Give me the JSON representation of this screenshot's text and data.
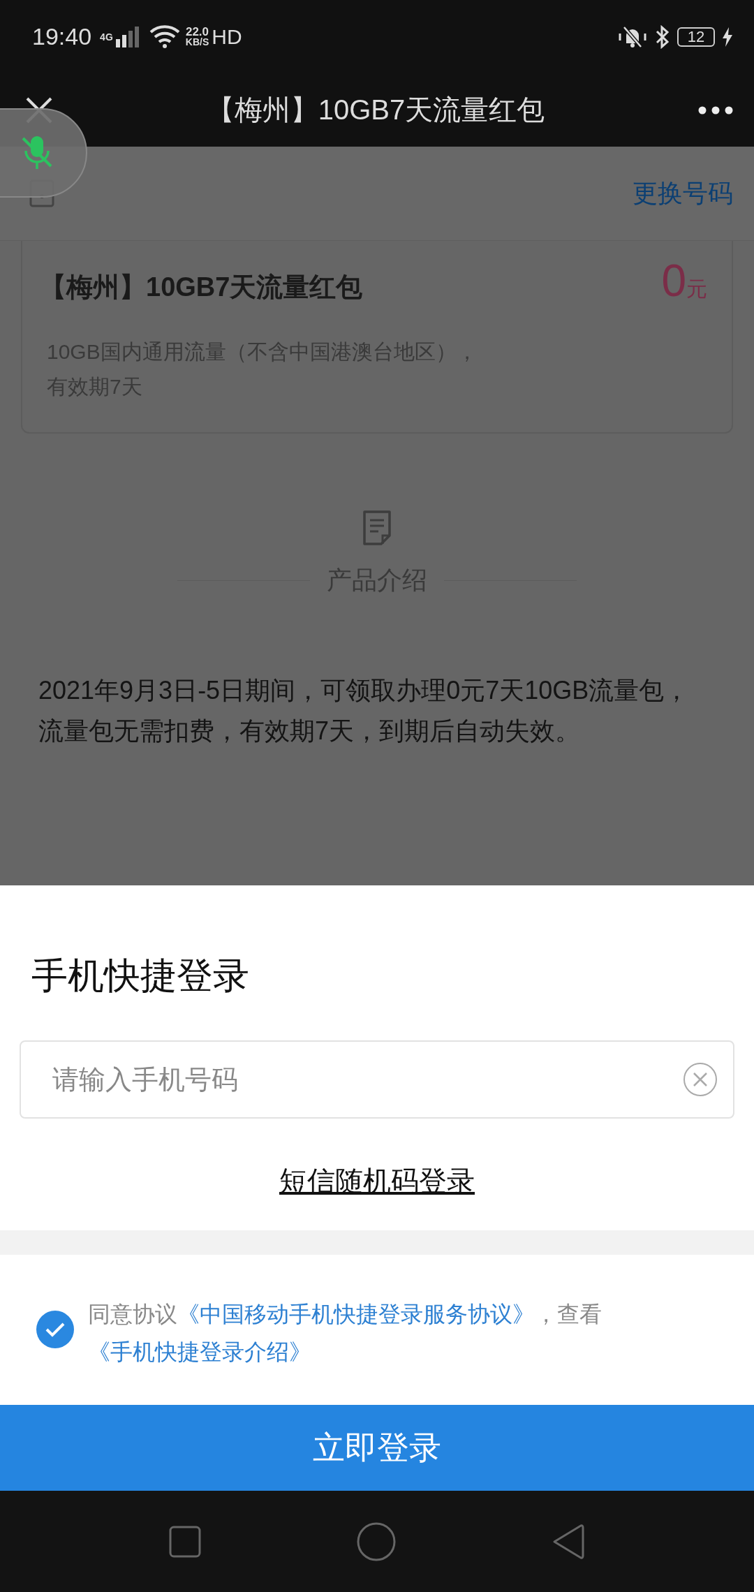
{
  "status_bar": {
    "time": "19:40",
    "network": "4G",
    "speed": "22.0",
    "speed_unit": "KB/S",
    "hd": "HD",
    "battery": "12"
  },
  "nav": {
    "title": "【梅州】10GB7天流量红包"
  },
  "page": {
    "change_number": "更换号码",
    "card": {
      "title": "【梅州】10GB7天流量红包",
      "price": "0",
      "unit": "元",
      "description": "10GB国内通用流量（不含中国港澳台地区），有效期7天"
    },
    "section_title": "产品介绍",
    "intro": "2021年9月3日-5日期间，可领取办理0元7天10GB流量包，流量包无需扣费，有效期7天，到期后自动失效。"
  },
  "login_sheet": {
    "title": "手机快捷登录",
    "phone_field": {
      "placeholder": "请输入手机号码"
    },
    "sms_link": "短信随机码登录",
    "agreement": {
      "checked": true,
      "parts": [
        {
          "kind": "text",
          "text": "同意协议"
        },
        {
          "kind": "link",
          "text": "《中国移动手机快捷登录服务协议》"
        },
        {
          "kind": "text",
          "text": "，查看"
        },
        {
          "kind": "link",
          "text": "《手机快捷登录介绍》"
        }
      ]
    },
    "login_button": "立即登录"
  }
}
